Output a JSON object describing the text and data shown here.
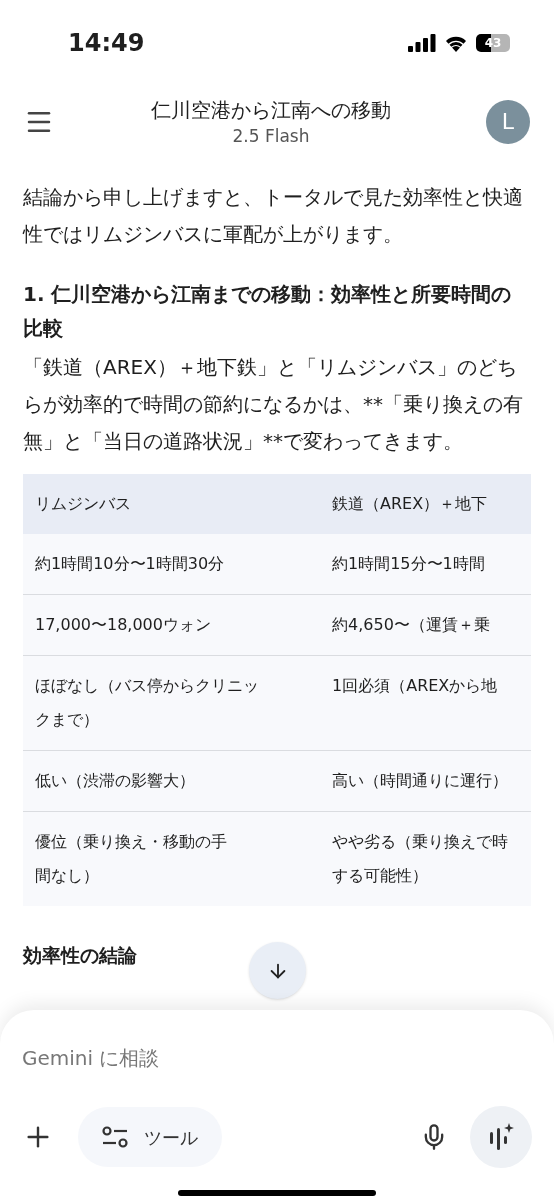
{
  "status_bar": {
    "time": "14:49",
    "battery": "43"
  },
  "header": {
    "title": "仁川空港から江南への移動",
    "subtitle": "2.5 Flash",
    "avatar": "L"
  },
  "body": [
    {
      "kind": "paragraph",
      "text": "結論から申し上げますと、トータルで見た効率性と快適性ではリムジンバスに軍配が上がります。"
    },
    {
      "kind": "heading",
      "text": "1. 仁川空港から江南までの移動：効率性と所要時間の比較"
    },
    {
      "kind": "paragraph",
      "text": "「鉄道（AREX）＋地下鉄」と「リムジンバス」のどちらが効率的で時間の節約になるかは、**「乗り換えの有無」と「当日の道路状況」**で変わってきます。"
    }
  ],
  "table": {
    "columns": [
      "リムジンバス",
      "鉄道（AREX）＋地下"
    ],
    "rows": [
      [
        [
          "約1時間10分〜1時間30分"
        ],
        [
          "約1時間15分〜1時間"
        ]
      ],
      [
        [
          "17,000〜18,000ウォン"
        ],
        [
          "約4,650〜（運賃＋乗"
        ]
      ],
      [
        [
          "ほぼなし（バス停からクリニッ",
          "クまで）"
        ],
        [
          "1回必須（AREXから地"
        ]
      ],
      [
        [
          "低い（渋滞の影響大）"
        ],
        [
          "高い（時間通りに運行）"
        ]
      ],
      [
        [
          "優位（乗り換え・移動の手",
          "間なし）"
        ],
        [
          "やや劣る（乗り換えで時",
          "する可能性）"
        ]
      ]
    ]
  },
  "after_heading": "効率性の結論",
  "composer": {
    "placeholder": "Gemini に相談",
    "tools_label": "ツール"
  }
}
